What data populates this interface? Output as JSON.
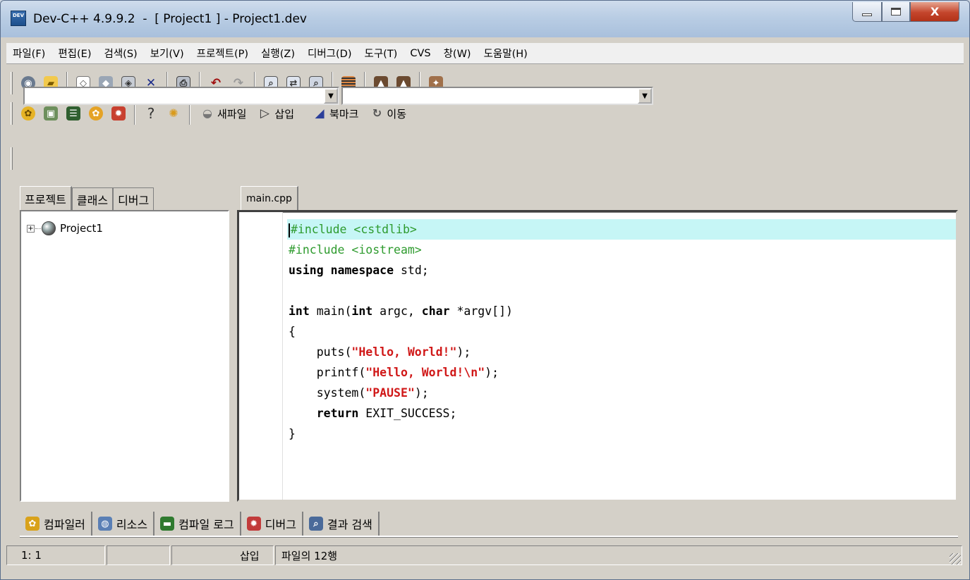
{
  "window": {
    "title": "Dev-C++ 4.9.9.2  -  [ Project1 ] - Project1.dev",
    "app_icon_text": "DEV",
    "controls": {
      "minimize": "minimize",
      "maximize": "maximize",
      "close": "X"
    }
  },
  "menu": [
    "파일(F)",
    "편집(E)",
    "검색(S)",
    "보기(V)",
    "프로젝트(P)",
    "실행(Z)",
    "디버그(D)",
    "도구(T)",
    "CVS",
    "창(W)",
    "도움말(H)"
  ],
  "toolbar2": {
    "help_glyph": "?",
    "new_file": "새파일",
    "insert": "삽입",
    "bookmark": "북마크",
    "goto": "이동"
  },
  "toolbar1_icons": [
    "project-icon",
    "open-folder-icon",
    "new-file-icon",
    "save-icon",
    "save-all-icon",
    "close-file-icon",
    "print-icon",
    "undo-icon",
    "redo-icon",
    "find-icon",
    "replace-icon",
    "find-next-icon",
    "goto-line-icon",
    "compile-icon",
    "run-icon",
    "rebuild-icon"
  ],
  "combos": {
    "class_combo": "",
    "member_combo": ""
  },
  "left_tabs": [
    "프로젝트",
    "클래스",
    "디버그"
  ],
  "tree": {
    "root": "Project1",
    "expander": "+"
  },
  "editor": {
    "tab": "main.cpp",
    "lines": [
      [
        {
          "t": "#include <cstdlib>",
          "c": "pre"
        }
      ],
      [
        {
          "t": "#include <iostream>",
          "c": "pre"
        }
      ],
      [
        {
          "t": "using namespace",
          "c": "kw"
        },
        {
          "t": " std;",
          "c": "normal"
        }
      ],
      [
        {
          "t": "",
          "c": "normal"
        }
      ],
      [
        {
          "t": "int",
          "c": "kw"
        },
        {
          "t": " main(",
          "c": "normal"
        },
        {
          "t": "int",
          "c": "kw"
        },
        {
          "t": " argc, ",
          "c": "normal"
        },
        {
          "t": "char",
          "c": "kw"
        },
        {
          "t": " *argv[])",
          "c": "normal"
        }
      ],
      [
        {
          "t": "{",
          "c": "normal"
        }
      ],
      [
        {
          "t": "    puts(",
          "c": "normal"
        },
        {
          "t": "\"Hello, World!\"",
          "c": "str"
        },
        {
          "t": ");",
          "c": "normal"
        }
      ],
      [
        {
          "t": "    printf(",
          "c": "normal"
        },
        {
          "t": "\"Hello, World!\\n\"",
          "c": "str"
        },
        {
          "t": ");",
          "c": "normal"
        }
      ],
      [
        {
          "t": "    system(",
          "c": "normal"
        },
        {
          "t": "\"PAUSE\"",
          "c": "str"
        },
        {
          "t": ");",
          "c": "normal"
        }
      ],
      [
        {
          "t": "    return",
          "c": "kw"
        },
        {
          "t": " EXIT_SUCCESS;",
          "c": "normal"
        }
      ],
      [
        {
          "t": "}",
          "c": "normal"
        }
      ]
    ],
    "highlight_line": 0
  },
  "bottom_tabs": [
    {
      "label": "컴파일러",
      "icon": "compiler-icon",
      "color": "#d9a21b"
    },
    {
      "label": "리소스",
      "icon": "resource-icon",
      "color": "#5a7fb5"
    },
    {
      "label": "컴파일 로그",
      "icon": "compile-log-icon",
      "color": "#2f7a2f"
    },
    {
      "label": "디버그",
      "icon": "debug-icon",
      "color": "#c23b3b"
    },
    {
      "label": "결과 검색",
      "icon": "search-results-icon",
      "color": "#4a6a9a"
    }
  ],
  "status": {
    "position": "1: 1",
    "modified": "",
    "mode": "삽입",
    "info": "파일의 12행"
  }
}
